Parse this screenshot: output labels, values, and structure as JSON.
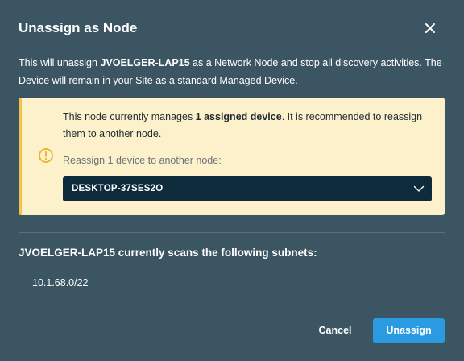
{
  "dialog": {
    "title": "Unassign as Node",
    "close_label": "Close"
  },
  "intro": {
    "part1": "This will unassign ",
    "device_name": "JVOELGER-LAP15",
    "part2": " as a Network Node and stop all discovery activities. The Device will remain in your Site as a standard Managed Device."
  },
  "warning": {
    "msg_part1": "This node currently manages ",
    "msg_bold": "1 assigned device",
    "msg_part2": ". It is recommended to reassign them to another node.",
    "reassign_label": "Reassign 1 device to another node:",
    "selected_node": "DESKTOP-37SES2O",
    "icon": "warning-circle-icon"
  },
  "subnets": {
    "title": "JVOELGER-LAP15 currently scans the following subnets:",
    "items": [
      "10.1.68.0/22"
    ]
  },
  "actions": {
    "cancel_label": "Cancel",
    "unassign_label": "Unassign"
  },
  "colors": {
    "background": "#3b5562",
    "warning_bg": "#fdf1cb",
    "warning_accent": "#f3c545",
    "select_bg": "#0e2b3c",
    "primary": "#2a9be1"
  }
}
